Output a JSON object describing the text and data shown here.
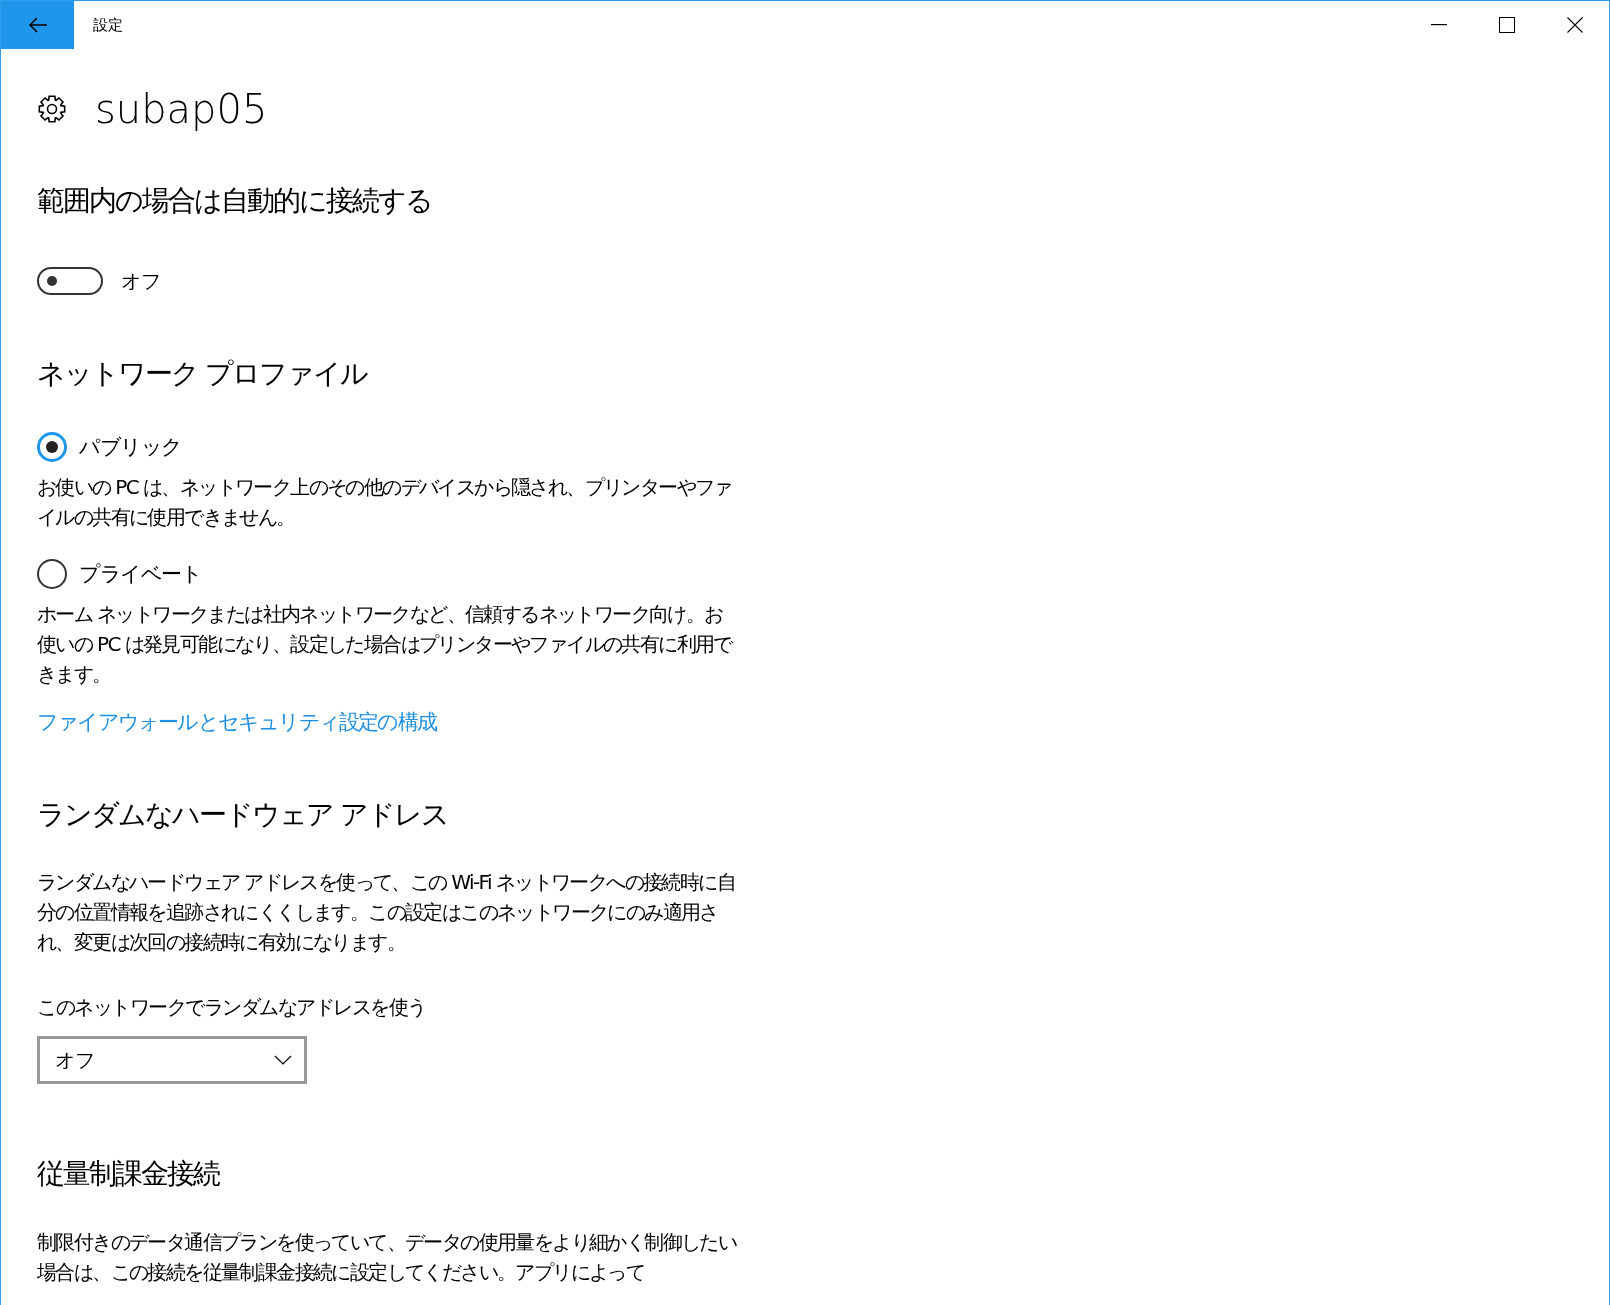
{
  "window": {
    "title": "設定"
  },
  "page": {
    "title": "subap05"
  },
  "sections": [
    {
      "kind": "toggle",
      "heading": "範囲内の場合は自動的に接続する",
      "toggle": {
        "on": false,
        "label": "オフ"
      }
    },
    {
      "kind": "radios",
      "heading": "ネットワーク プロファイル",
      "options": [
        {
          "label": "パブリック",
          "selected": true,
          "description": "お使いの PC は、ネットワーク上のその他のデバイスから隠され、プリンターやファイルの共有に使用できません。"
        },
        {
          "label": "プライベート",
          "selected": false,
          "description": "ホーム ネットワークまたは社内ネットワークなど、信頼するネットワーク向け。お使いの PC は発見可能になり、設定した場合はプリンターやファイルの共有に利用できます。"
        }
      ],
      "link": "ファイアウォールとセキュリティ設定の構成"
    },
    {
      "kind": "dropdown",
      "heading": "ランダムなハードウェア アドレス",
      "description": "ランダムなハードウェア アドレスを使って、この Wi-Fi ネットワークへの接続時に自分の位置情報を追跡されにくくします。この設定はこのネットワークにのみ適用され、変更は次回の接続時に有効になります。",
      "field_label": "このネットワークでランダムなアドレスを使う",
      "value": "オフ"
    },
    {
      "kind": "text",
      "heading": "従量制課金接続",
      "description": "制限付きのデータ通信プランを使っていて、データの使用量をより細かく制御したい場合は、この接続を従量制課金接続に設定してください。アプリによって"
    }
  ]
}
